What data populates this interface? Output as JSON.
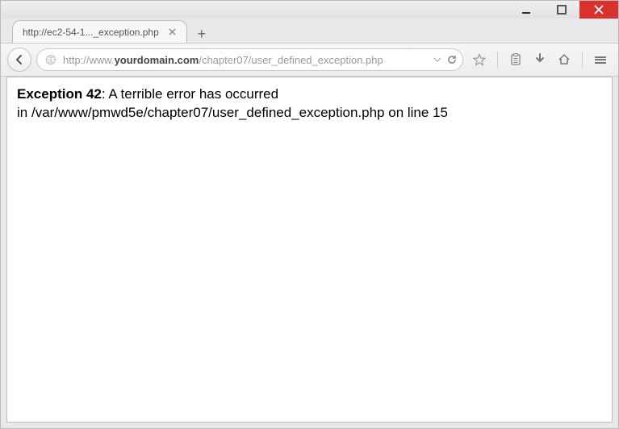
{
  "window": {
    "tab_title": "http://ec2-54-1..._exception.php"
  },
  "url": {
    "prefix": "http://www.",
    "domain": "yourdomain.com",
    "path": "/chapter07/user_defined_exception.php"
  },
  "content": {
    "exception_label": "Exception 42",
    "sep": ": ",
    "message": "A terrible error has occurred",
    "location_prefix": "in ",
    "file_path": "/var/www/pmwd5e/chapter07/user_defined_exception.php",
    "line_text": " on line ",
    "line_number": "15"
  }
}
